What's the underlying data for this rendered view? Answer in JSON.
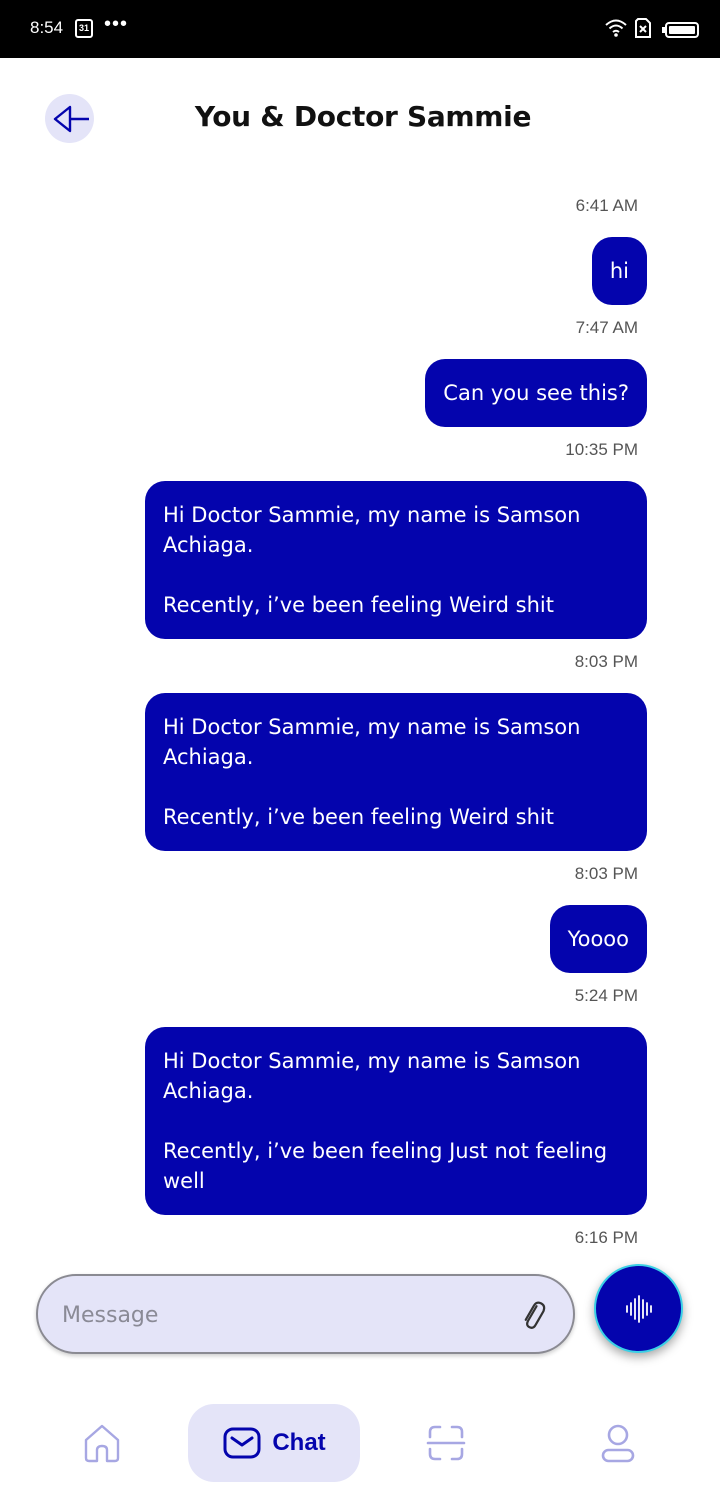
{
  "status_bar": {
    "time": "8:54",
    "calendar_day": "31",
    "more": "•••"
  },
  "header": {
    "title": "You & Doctor Sammie"
  },
  "messages": [
    {
      "time": "6:41 AM",
      "text": "hi"
    },
    {
      "time": "7:47 AM",
      "text": "Can you see this?"
    },
    {
      "time": "10:35 PM",
      "text": "Hi Doctor Sammie, my name is Samson Achiaga.\n\nRecently, i’ve been feeling Weird shit"
    },
    {
      "time": "8:03 PM",
      "text": "Hi Doctor Sammie, my name is Samson Achiaga.\n\nRecently, i’ve been feeling Weird shit"
    },
    {
      "time": "8:03 PM",
      "text": "Yoooo"
    },
    {
      "time": "5:24 PM",
      "text": "Hi Doctor Sammie, my name is Samson Achiaga.\n\nRecently, i’ve been feeling Just not feeling well"
    },
    {
      "time": "6:16 PM",
      "text": ""
    }
  ],
  "composer": {
    "placeholder": "Message",
    "value": ""
  },
  "bottom_nav": {
    "items": [
      {
        "id": "home",
        "label": "",
        "icon": "home-icon"
      },
      {
        "id": "chat",
        "label": "Chat",
        "icon": "mail-icon",
        "active": true
      },
      {
        "id": "scan",
        "label": "",
        "icon": "scan-icon"
      },
      {
        "id": "profile",
        "label": "",
        "icon": "user-icon"
      }
    ]
  },
  "colors": {
    "accent": "#0404ad",
    "accent_light": "#e4e4f8",
    "nav_inactive": "#a7a7e3"
  }
}
